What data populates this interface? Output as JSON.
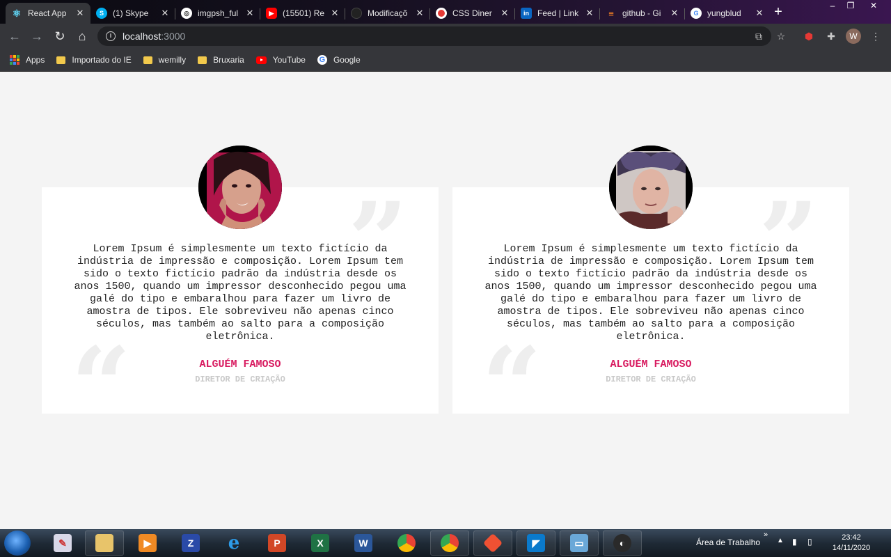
{
  "browser": {
    "tabs": [
      {
        "title": "React App",
        "icon": "react-icon",
        "active": true
      },
      {
        "title": "(1) Skype",
        "icon": "skype-icon"
      },
      {
        "title": "imgpsh_ful",
        "icon": "globe-icon"
      },
      {
        "title": "(15501) Re",
        "icon": "youtube-icon"
      },
      {
        "title": "Modificaçõ",
        "icon": "github-icon"
      },
      {
        "title": "CSS Diner",
        "icon": "css-diner-icon"
      },
      {
        "title": "Feed | Link",
        "icon": "linkedin-icon"
      },
      {
        "title": "github - Gi",
        "icon": "stackoverflow-icon"
      },
      {
        "title": "yungblud",
        "icon": "google-icon"
      }
    ],
    "new_tab_label": "+",
    "window_controls": [
      "–",
      "❐",
      "✕"
    ],
    "url": {
      "host": "localhost",
      "port": ":3000"
    },
    "profile_initial": "W",
    "bookmarks": [
      {
        "label": "Apps",
        "icon": "apps-grid-icon"
      },
      {
        "label": "Importado do IE",
        "icon": "folder-icon"
      },
      {
        "label": "wemilly",
        "icon": "folder-icon"
      },
      {
        "label": "Bruxaria",
        "icon": "folder-icon"
      },
      {
        "label": "YouTube",
        "icon": "youtube-icon"
      },
      {
        "label": "Google",
        "icon": "google-icon"
      }
    ]
  },
  "testimonials": [
    {
      "text": "Lorem Ipsum é simplesmente um texto fictício da indústria de impressão e composição. Lorem Ipsum tem sido o texto fictício padrão da indústria desde os anos 1500, quando um impressor desconhecido pegou uma galé do tipo e embaralhou para fazer um livro de amostra de tipos. Ele sobreviveu não apenas cinco séculos, mas também ao salto para a composição eletrônica.",
      "name": "ALGUÉM FAMOSO",
      "role": "DIRETOR DE CRIAÇÃO"
    },
    {
      "text": "Lorem Ipsum é simplesmente um texto fictício da indústria de impressão e composição. Lorem Ipsum tem sido o texto fictício padrão da indústria desde os anos 1500, quando um impressor desconhecido pegou uma galé do tipo e embaralhou para fazer um livro de amostra de tipos. Ele sobreviveu não apenas cinco séculos, mas também ao salto para a composição eletrônica.",
      "name": "ALGUÉM FAMOSO",
      "role": "DIRETOR DE CRIAÇÃO"
    }
  ],
  "quote_marks": {
    "open": "“",
    "close": "”"
  },
  "taskbar": {
    "desktop_label": "Área de Trabalho",
    "chevron": "»",
    "time": "23:42",
    "date": "14/11/2020"
  },
  "colors": {
    "accent": "#d81b60",
    "role": "#c9c9c9",
    "page_bg": "#f4f4f4",
    "card_bg": "#ffffff"
  }
}
